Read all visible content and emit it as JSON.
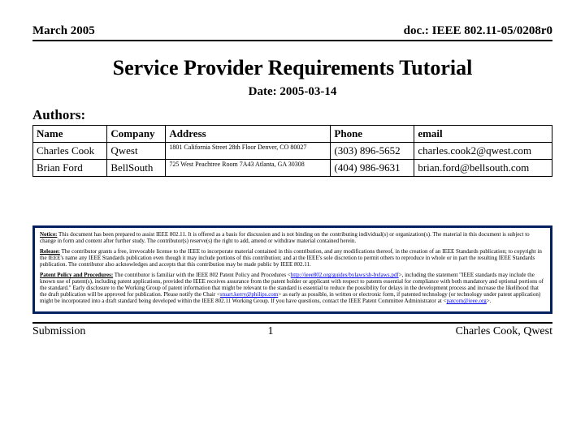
{
  "header": {
    "left": "March 2005",
    "right": "doc.: IEEE 802.11-05/0208r0"
  },
  "title": "Service Provider Requirements Tutorial",
  "date_line": "Date: 2005-03-14",
  "authors_label": "Authors:",
  "table": {
    "headers": [
      "Name",
      "Company",
      "Address",
      "Phone",
      "email"
    ],
    "rows": [
      {
        "name": "Charles Cook",
        "company": "Qwest",
        "address": "1801 California Street\n28th Floor\nDenver, CO 80027",
        "phone": "(303) 896-5652",
        "email": "charles.cook2@qwest.com"
      },
      {
        "name": "Brian Ford",
        "company": "BellSouth",
        "address": "725 West Peachtree\nRoom 7A43\nAtlanta, GA 30308",
        "phone": "(404) 986-9631",
        "email": "brian.ford@bellsouth.com"
      }
    ]
  },
  "notice": {
    "p1_lead": "Notice:",
    "p1": " This document has been prepared to assist IEEE 802.11. It is offered as a basis for discussion and is not binding on the contributing individual(s) or organization(s). The material in this document is subject to change in form and content after further study. The contributor(s) reserve(s) the right to add, amend or withdraw material contained herein.",
    "p2_lead": "Release:",
    "p2": " The contributor grants a free, irrevocable license to the IEEE to incorporate material contained in this contribution, and any modifications thereof, in the creation of an IEEE Standards publication; to copyright in the IEEE's name any IEEE Standards publication even though it may include portions of this contribution; and at the IEEE's sole discretion to permit others to reproduce in whole or in part the resulting IEEE Standards publication. The contributor also acknowledges and accepts that this contribution may be made public by IEEE 802.11.",
    "p3_lead": "Patent Policy and Procedures:",
    "p3a": " The contributor is familiar with the IEEE 802 Patent Policy and Procedures <",
    "p3_link1": "http://ieee802.org/guides/bylaws/sb-bylaws.pdf",
    "p3b": ">, including the statement \"IEEE standards may include the known use of patent(s), including patent applications, provided the IEEE receives assurance from the patent holder or applicant with respect to patents essential for compliance with both mandatory and optional portions of the standard.\" Early disclosure to the Working Group of patent information that might be relevant to the standard is essential to reduce the possibility for delays in the development process and increase the likelihood that the draft publication will be approved for publication. Please notify the Chair <",
    "p3_link2": "stuart.kerry@philips.com",
    "p3c": "> as early as possible, in written or electronic form, if patented technology (or technology under patent application) might be incorporated into a draft standard being developed within the IEEE 802.11 Working Group. If you have questions, contact the IEEE Patent Committee Administrator at <",
    "p3_link3": "patcom@ieee.org",
    "p3d": ">."
  },
  "footer": {
    "left": "Submission",
    "center": "1",
    "right": "Charles Cook, Qwest"
  }
}
